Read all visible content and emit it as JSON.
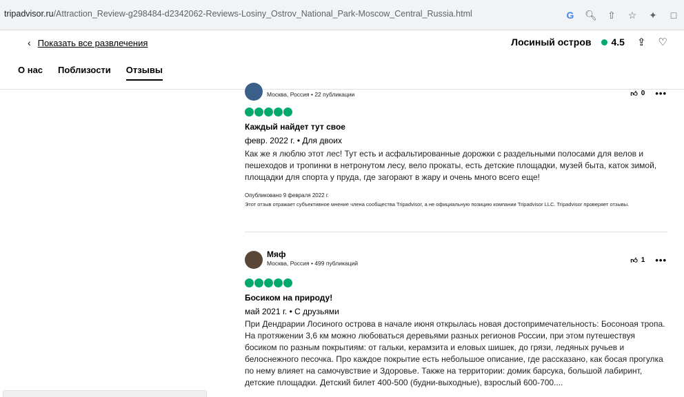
{
  "browser": {
    "url_host": "tripadvisor.ru",
    "url_path": "/Attraction_Review-g298484-d2342062-Reviews-Losiny_Ostrov_National_Park-Moscow_Central_Russia.html",
    "icons": [
      "google-icon",
      "zoom-icon",
      "share-icon",
      "star-icon",
      "extension-icon",
      "window-icon"
    ]
  },
  "header": {
    "back_label": "Показать все развлечения",
    "place_name": "Лосиный остров",
    "rating": "4.5",
    "tabs": [
      {
        "label": "О нас",
        "active": false
      },
      {
        "label": "Поблизости",
        "active": false
      },
      {
        "label": "Отзывы",
        "active": true
      }
    ]
  },
  "reviews": [
    {
      "author": "",
      "meta": "Москва, Россия • 22 публикации",
      "helpful_count": "0",
      "bubbles": 5,
      "title": "Каждый найдет тут свое",
      "date": "февр. 2022 г. • Для двоих",
      "text": "Как же я люблю этот лес! Тут есть и асфальтированные дорожки с раздельными полосами для велов и пешеходов и тропинки в нетронутом лесу, вело прокаты, есть детские площадки, музей быта, каток зимой, площадки для спорта у пруда, где загорают в жару и очень много всего еще!",
      "published": "Опубликовано 9 февраля 2022 г.",
      "disclaimer": "Этот отзыв отражает субъективное мнение члена сообщества Tripadvisor, а не официальную позицию компании Tripadvisor LLC. Tripadvisor проверяет отзывы."
    },
    {
      "author": "Мяф",
      "meta": "Москва, Россия • 499 публикаций",
      "helpful_count": "1",
      "bubbles": 5,
      "title": "Босиком на природу!",
      "date": "май 2021 г. • С друзьями",
      "text": "При Дендрарии Лосиного острова в начале июня открылась новая достопримечательность: Босоноая тропа. На протяжении 3,6 км можно любоваться деревьями разных регионов России, при этом путешествуя босиком по разным покрытиям: от гальки, керамзита и еловых шишек, до грязи, ледяных ручьев и белоснежного песочка. Про каждое покрытие есть небольшое описание, где рассказано, как босая прогулка по нему влияет на самочувствие и Здоровье. Также на территории: домик барсука, большой лабиринт, детские площадки. Детский билет 400-500 (будни-выходные), взрослый 600-700...."
    }
  ]
}
